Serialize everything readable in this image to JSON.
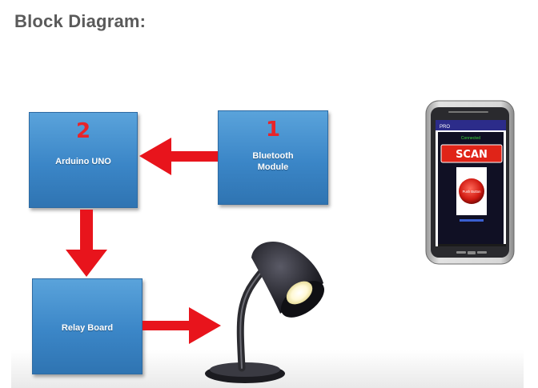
{
  "page": {
    "heading": "Block Diagram:"
  },
  "diagram": {
    "blocks": {
      "arduino": {
        "number": "2",
        "label": "Arduino UNO"
      },
      "bluetooth": {
        "number": "1",
        "label_line1": "Bluetooth",
        "label_line2": "Module"
      },
      "relay": {
        "label": "Relay Board"
      }
    },
    "phone": {
      "app_title": "PRO",
      "status": "Connected",
      "scan_label": "SCAN",
      "push_label": "Push Button"
    },
    "colors": {
      "block": "#3b86c7",
      "arrow": "#e8141c",
      "number": "#e8242a"
    }
  }
}
